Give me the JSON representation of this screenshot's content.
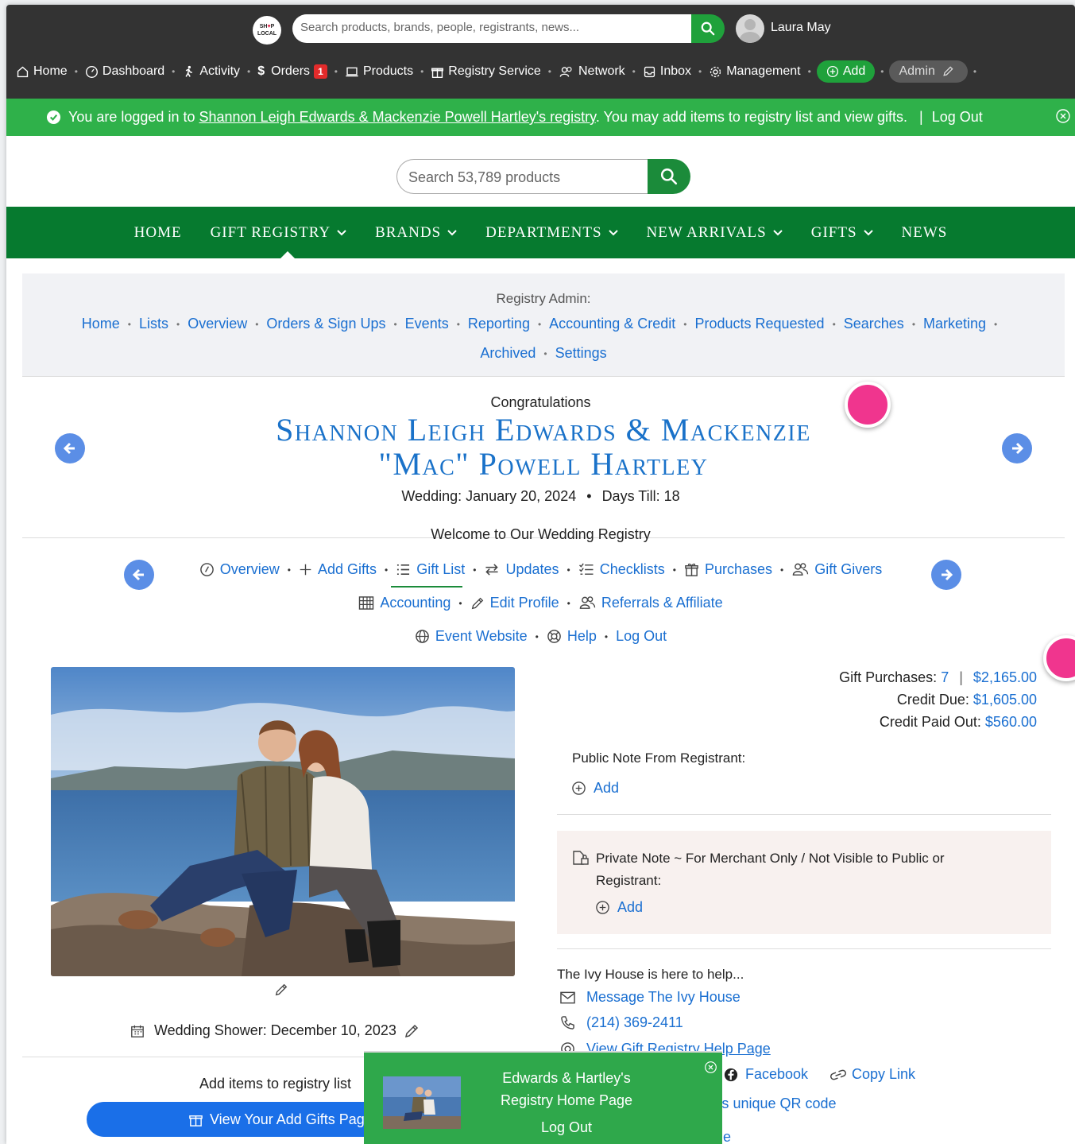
{
  "topbar": {
    "logo_text": "SHOP LOCAL",
    "search_placeholder": "Search products, brands, people, registrants, news...",
    "user_name": "Laura May",
    "nav": [
      {
        "label": "Home",
        "icon": "home-icon"
      },
      {
        "label": "Dashboard",
        "icon": "dashboard-icon"
      },
      {
        "label": "Activity",
        "icon": "activity-icon"
      },
      {
        "label": "Orders",
        "icon": "dollar-icon",
        "badge": "1"
      },
      {
        "label": "Products",
        "icon": "products-icon"
      },
      {
        "label": "Registry Service",
        "icon": "gift-icon"
      },
      {
        "label": "Network",
        "icon": "network-icon"
      },
      {
        "label": "Inbox",
        "icon": "inbox-icon"
      },
      {
        "label": "Management",
        "icon": "gear-icon"
      }
    ],
    "add_label": "Add",
    "admin_label": "Admin"
  },
  "banner": {
    "prefix": "You are logged in to ",
    "registry_link": "Shannon Leigh Edwards & Mackenzie Powell Hartley's registry",
    "suffix": ". You may add items to registry list and view gifts.",
    "divider": "|",
    "logout": "Log Out"
  },
  "shop_search": {
    "placeholder": "Search 53,789 products"
  },
  "main_nav": [
    {
      "label": "HOME",
      "dropdown": false
    },
    {
      "label": "GIFT REGISTRY",
      "dropdown": true
    },
    {
      "label": "BRANDS",
      "dropdown": true
    },
    {
      "label": "DEPARTMENTS",
      "dropdown": true
    },
    {
      "label": "NEW ARRIVALS",
      "dropdown": true
    },
    {
      "label": "GIFTS",
      "dropdown": true
    },
    {
      "label": "NEWS",
      "dropdown": false
    }
  ],
  "registry_admin": {
    "title": "Registry Admin:",
    "links_row1": [
      "Home",
      "Lists",
      "Overview",
      "Orders & Sign Ups",
      "Events",
      "Reporting",
      "Accounting & Credit",
      "Products Requested",
      "Searches",
      "Marketing"
    ],
    "links_row2": [
      "Archived",
      "Settings"
    ]
  },
  "registry": {
    "congrats": "Congratulations",
    "names_line1": "Shannon Leigh Edwards & Mackenzie",
    "names_line2": "\"Mac\" Powell Hartley",
    "wedding": "Wedding: January 20, 2024",
    "days_till": "Days Till: 18",
    "welcome": "Welcome to Our Wedding Registry"
  },
  "registry_nav": {
    "row1": [
      {
        "label": "Overview",
        "icon": "overview-icon"
      },
      {
        "label": "Add Gifts",
        "icon": "plus-icon"
      },
      {
        "label": "Gift List",
        "icon": "list-icon"
      },
      {
        "label": "Updates",
        "icon": "updates-icon"
      },
      {
        "label": "Checklists",
        "icon": "checklist-icon"
      },
      {
        "label": "Purchases",
        "icon": "gift-icon"
      },
      {
        "label": "Gift Givers",
        "icon": "people-icon"
      }
    ],
    "row2": [
      {
        "label": "Accounting",
        "icon": "table-icon"
      },
      {
        "label": "Edit Profile",
        "icon": "pencil-icon"
      },
      {
        "label": "Referrals & Affiliate",
        "icon": "people-icon"
      }
    ],
    "row3": [
      {
        "label": "Event Website",
        "icon": "globe-icon"
      },
      {
        "label": "Help",
        "icon": "lifebuoy-icon"
      },
      {
        "label": "Log Out",
        "icon": ""
      }
    ]
  },
  "stats": {
    "gift_purchases_label": "Gift Purchases:",
    "gift_purchases_count": "7",
    "gift_purchases_total": "$2,165.00",
    "credit_due_label": "Credit Due:",
    "credit_due": "$1,605.00",
    "credit_paid_label": "Credit Paid Out:",
    "credit_paid": "$560.00"
  },
  "notes": {
    "public_label": "Public Note From Registrant:",
    "public_add": "Add",
    "private_label": "Private Note ~ For Merchant Only / Not Visible to Public or Registrant:",
    "private_add": "Add"
  },
  "help": {
    "heading": "The Ivy House is here to help...",
    "message": "Message The Ivy House",
    "phone": "(214) 369-2411",
    "help_page": "View Gift Registry Help Page",
    "facebook": "Facebook",
    "copy_link": "Copy Link",
    "qr_partial": "'s unique QR code",
    "partial_e": "e"
  },
  "photo_section": {
    "shower": "Wedding Shower: December 10, 2023",
    "add_items": "Add items to registry list",
    "view_add_gifts": "View Your Add Gifts Page"
  },
  "popup": {
    "title_line1": "Edwards & Hartley's",
    "title_line2": "Registry Home Page",
    "logout": "Log Out"
  },
  "colors": {
    "topbar": "#333333",
    "banner": "#2fb14a",
    "main_nav": "#067a2f",
    "link": "#1a6fd1",
    "names": "#1a72c9",
    "accent_pink": "#f0358e"
  }
}
